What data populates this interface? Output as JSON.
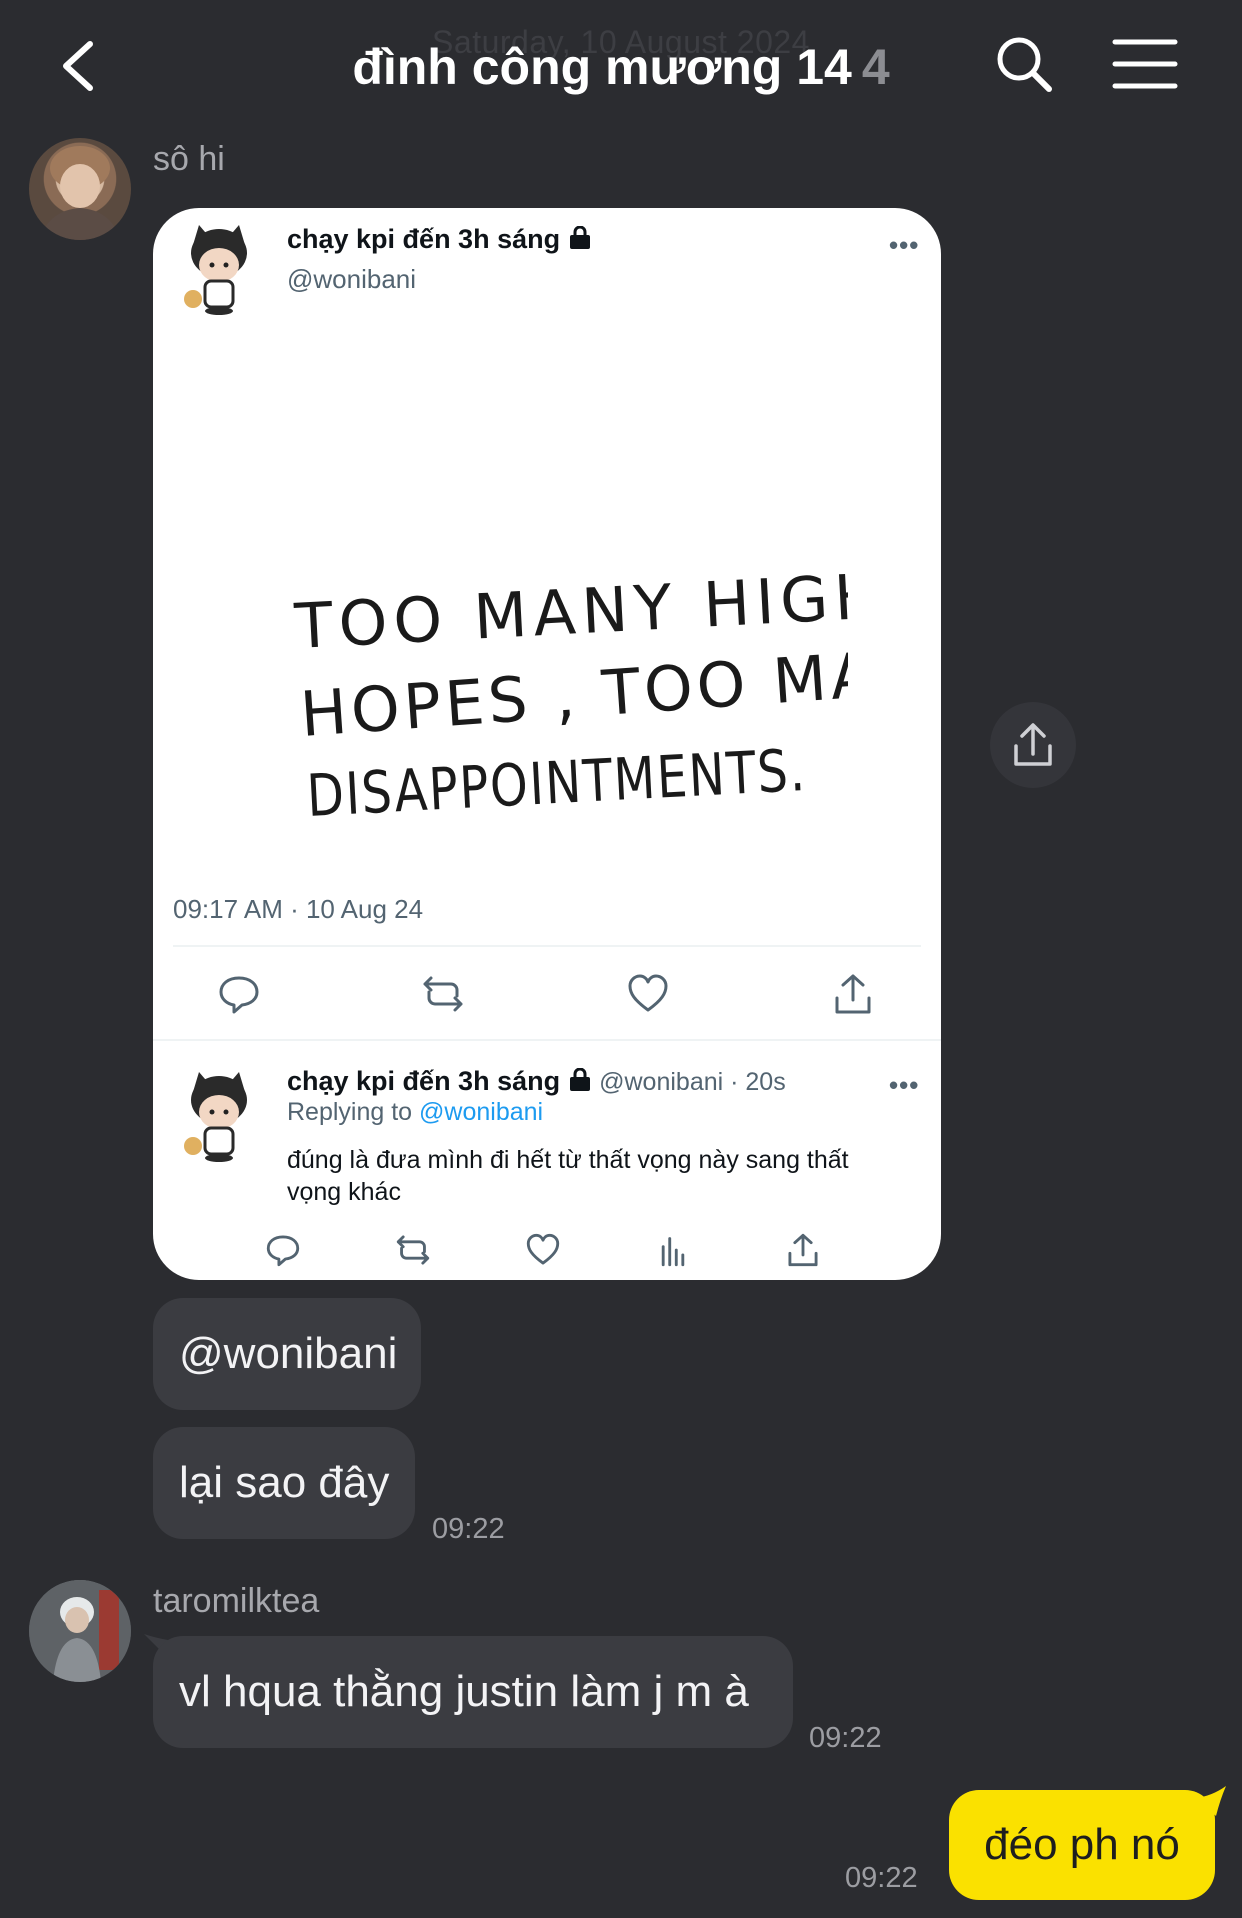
{
  "header": {
    "date_ghost": "Saturday, 10 August 2024",
    "title": "đình công mương 14",
    "member_count": "4"
  },
  "messages": {
    "sender_1": "sô hi",
    "tweet": {
      "display_name": "chạy kpi đến 3h sáng",
      "handle": "@wonibani",
      "image_text_line1": "TOO MANY HIGH",
      "image_text_line2": "HOPES , TOO MANY",
      "image_text_line3": "DISAPPOINTMENTS.",
      "timestamp": "09:17 AM · 10 Aug 24",
      "reply": {
        "display_name": "chạy kpi đến 3h sáng",
        "handle_time": "@wonibani · 20s",
        "replying_prefix": "Replying to",
        "replying_handle": "@wonibani",
        "body": "đúng là đưa mình đi hết từ thất vọng này sang thất vọng khác"
      }
    },
    "bubble_1": "@wonibani",
    "bubble_2": "lại sao đây",
    "time_1": "09:22",
    "sender_2": "taromilktea",
    "bubble_3": "vl hqua thằng justin làm j m à",
    "time_2": "09:22",
    "my_bubble": "đéo ph nó",
    "time_3": "09:22"
  },
  "colors": {
    "background": "#2b2c30",
    "bubble_other": "#3b3c41",
    "bubble_me": "#fae100",
    "link_blue": "#1d9bf0"
  },
  "icons": {
    "back": "chevron-left-icon",
    "search": "search-icon",
    "menu": "hamburger-menu-icon",
    "share": "share-icon"
  }
}
